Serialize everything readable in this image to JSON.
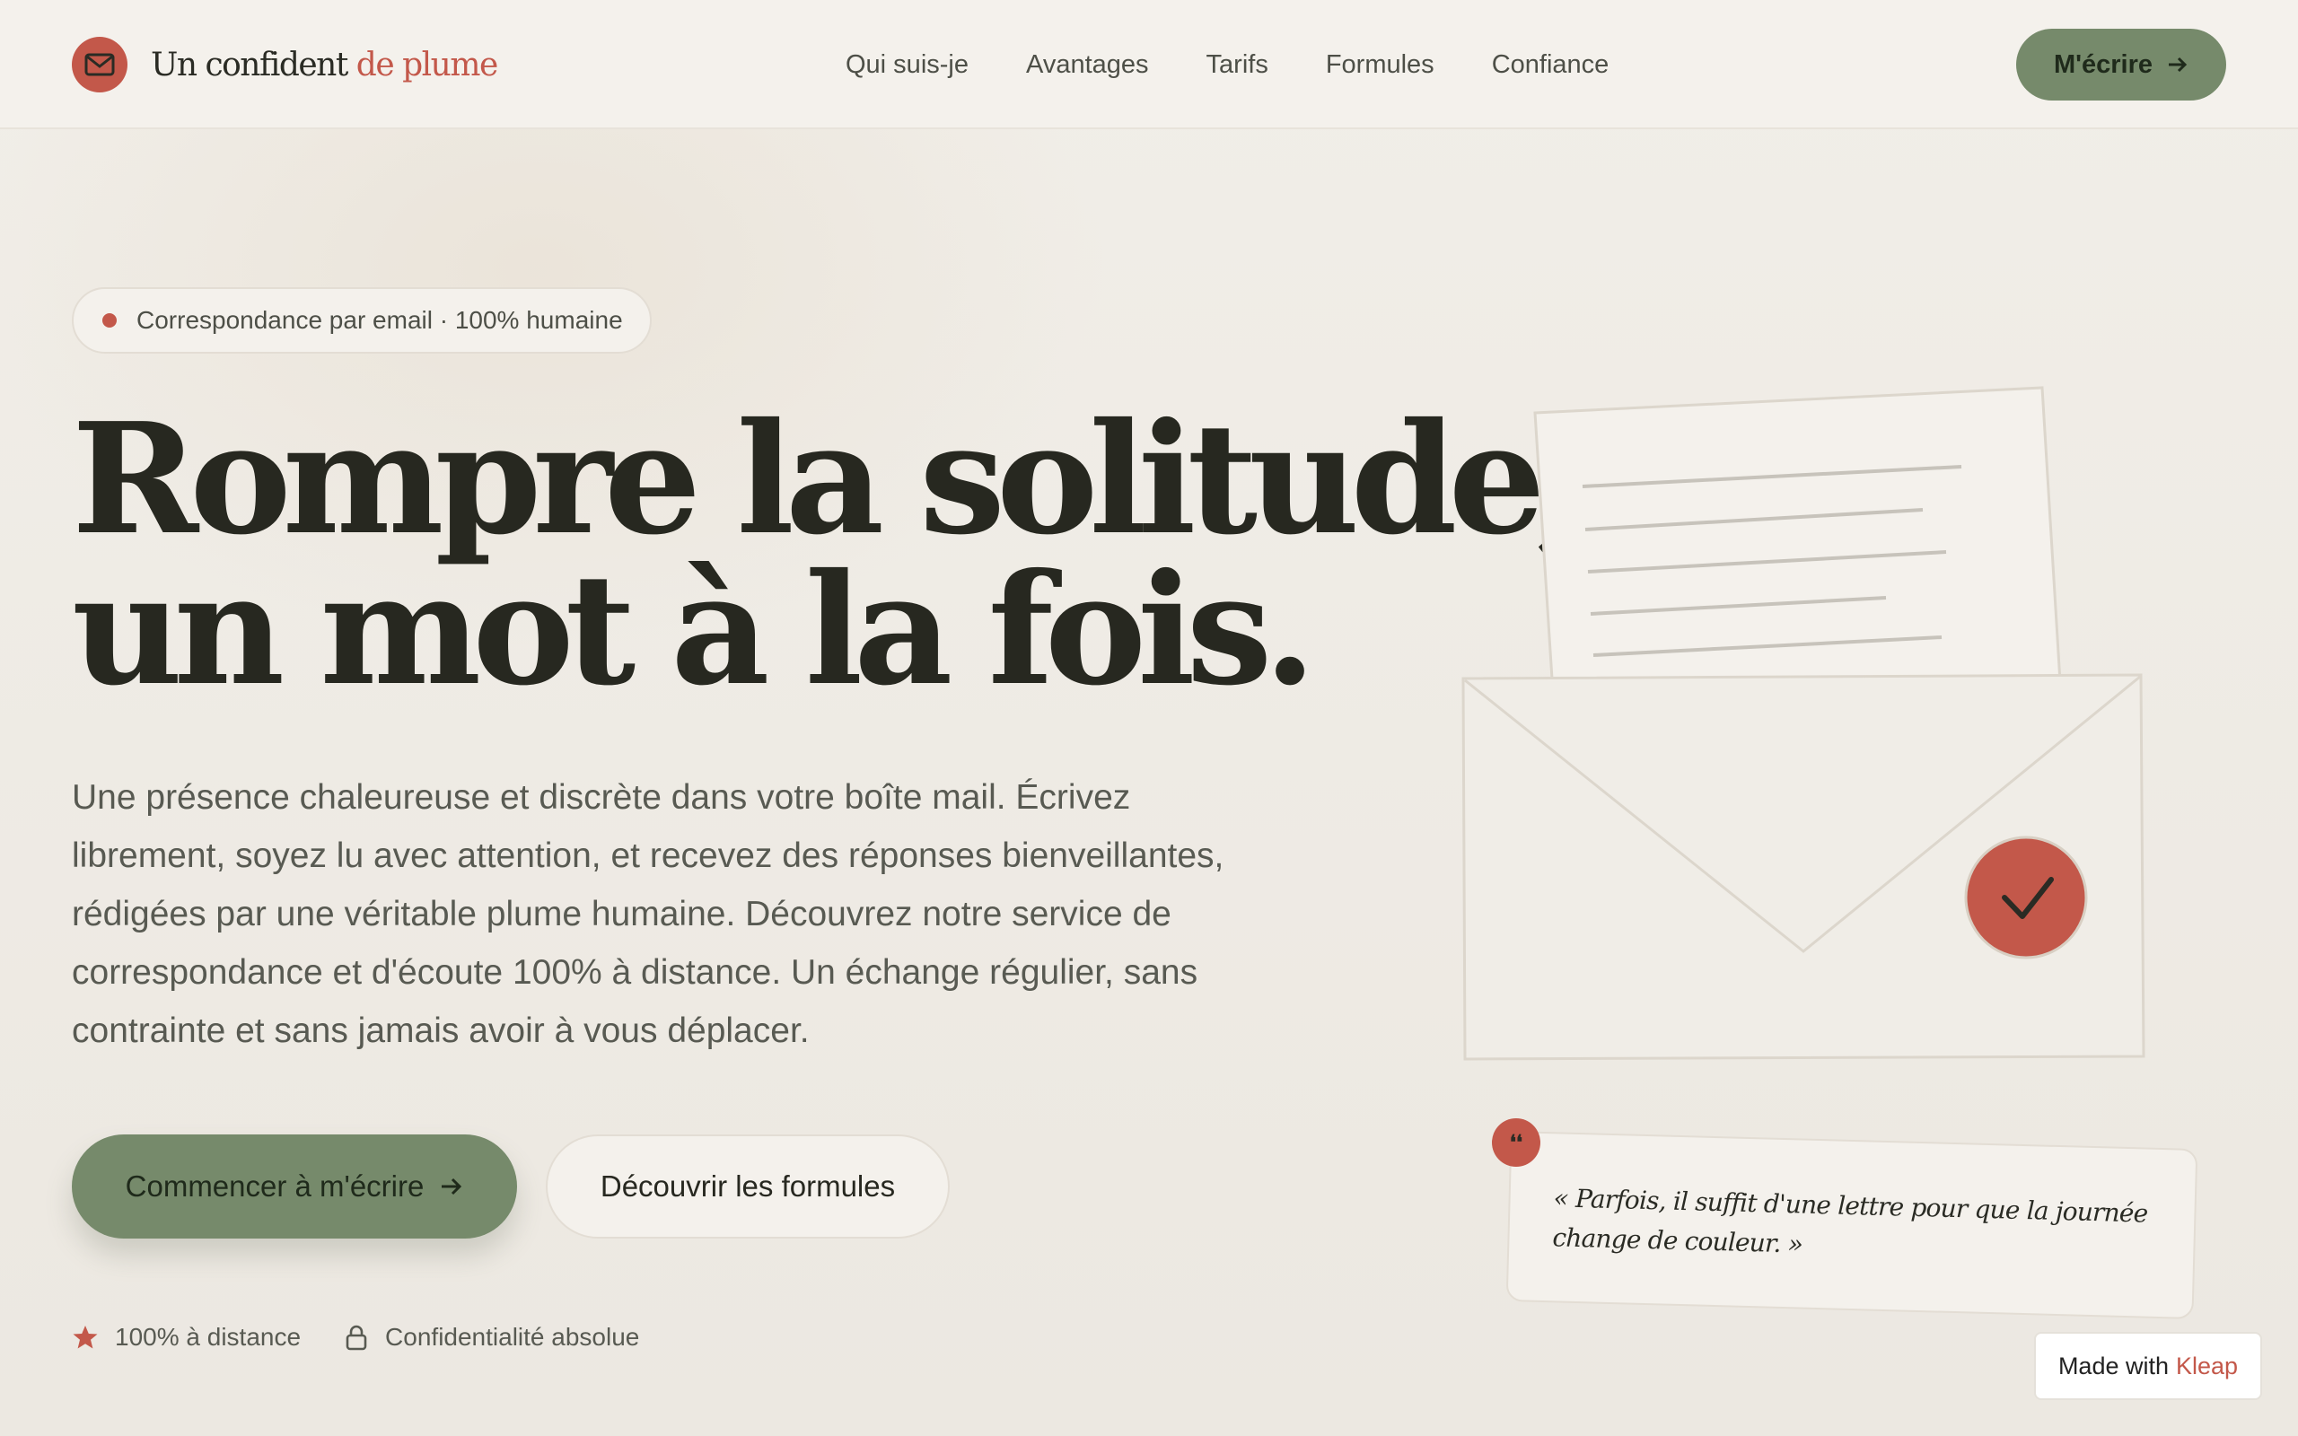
{
  "header": {
    "logo_icon": "envelope-icon",
    "logo_main": "Un confident",
    "logo_accent": "de plume",
    "nav": [
      "Qui suis-je",
      "Avantages",
      "Tarifs",
      "Formules",
      "Confiance"
    ],
    "cta_label": "M'écrire",
    "cta_icon": "arrow-right-icon"
  },
  "hero": {
    "badge": "Correspondance par email · 100% humaine",
    "headline_line1": "Rompre la solitude,",
    "headline_line2": "un mot à la fois.",
    "lead": "Une présence chaleureuse et discrète dans votre boîte mail. Écrivez librement, soyez lu avec attention, et recevez des réponses bienveillantes, rédigées par une véritable plume humaine. Découvrez notre service de correspondance et d'écoute 100% à distance. Un échange régulier, sans contrainte et sans jamais avoir à vous déplacer.",
    "primary_cta": "Commencer à m'écrire",
    "secondary_cta": "Découvrir les formules",
    "trust": [
      {
        "icon": "star-icon",
        "label": "100% à distance"
      },
      {
        "icon": "lock-icon",
        "label": "Confidentialité absolue"
      }
    ]
  },
  "illustration": {
    "icons": [
      "letter-icon",
      "envelope-icon",
      "check-icon",
      "quote-icon"
    ],
    "quote": "« Parfois, il suffit d'une lettre pour que la journée change de couleur. »"
  },
  "footer_badge": {
    "prefix": "Made with",
    "brand": "Kleap"
  },
  "colors": {
    "accent": "#c3584a",
    "primary_button": "#768a6b",
    "highlight": "#d7bca6",
    "background": "#efebe5"
  }
}
